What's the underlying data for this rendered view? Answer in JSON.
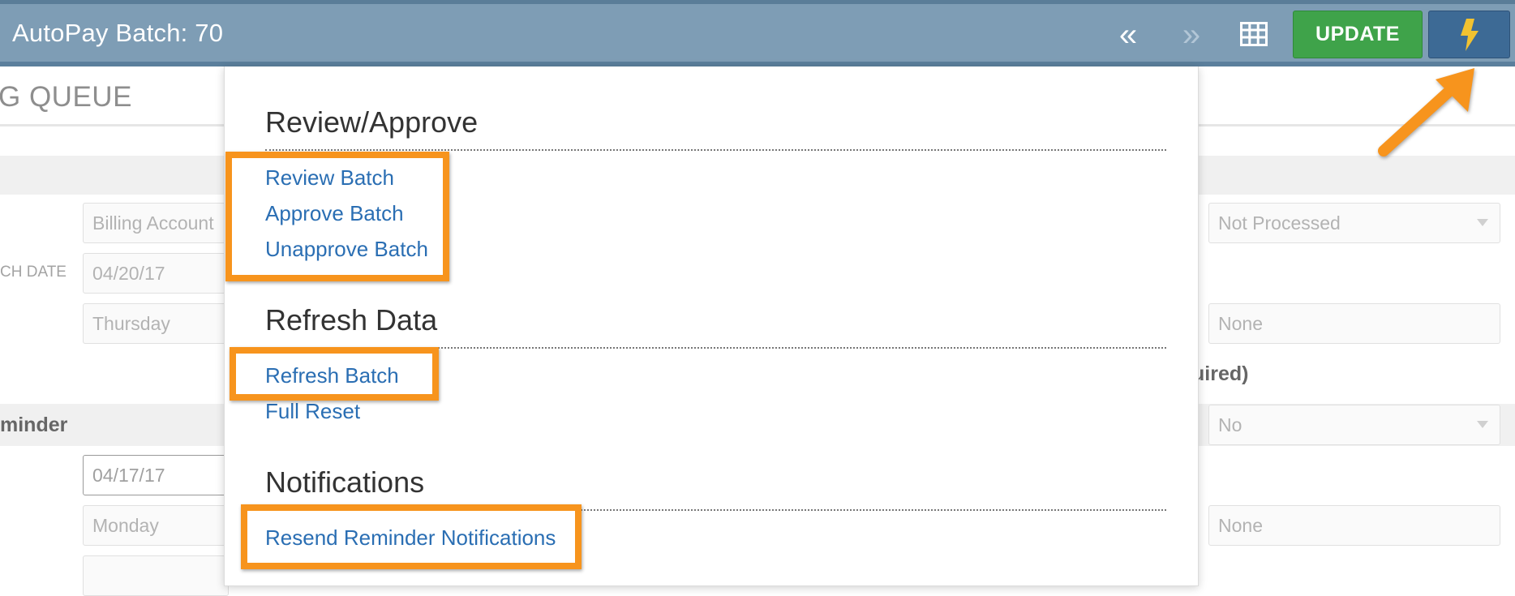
{
  "header": {
    "title": "AutoPay Batch: 70",
    "prev_glyph": "«",
    "next_glyph": "»",
    "update_label": "UPDATE",
    "grid_icon": "table-grid-icon",
    "bolt_icon": "lightning-bolt-icon"
  },
  "page": {
    "title": "G QUEUE",
    "labels": {
      "launch_date": "CH DATE",
      "reminder": "minder",
      "required_suffix": "uired)"
    },
    "fields": {
      "billing_account_placeholder": "Billing Account",
      "launch_date": "04/20/17",
      "launch_day": "Thursday",
      "reminder_date": "04/17/17",
      "reminder_day": "Monday",
      "status": "Not Processed",
      "right_none_1": "None",
      "right_no": "No",
      "right_none_2": "None"
    }
  },
  "menu": {
    "sections": [
      {
        "title": "Review/Approve",
        "items": [
          "Review Batch",
          "Approve Batch",
          "Unapprove Batch"
        ]
      },
      {
        "title": "Refresh Data",
        "items": [
          "Refresh Batch",
          "Full Reset"
        ]
      },
      {
        "title": "Notifications",
        "items": [
          "Resend Reminder Notifications"
        ]
      }
    ]
  },
  "colors": {
    "header_bg": "#7e9db5",
    "update_green": "#3fa34a",
    "bolt_button_blue": "#3d6a95",
    "bolt_yellow": "#f2c230",
    "link_blue": "#2a6eb3",
    "annotation_orange": "#f7941d"
  }
}
